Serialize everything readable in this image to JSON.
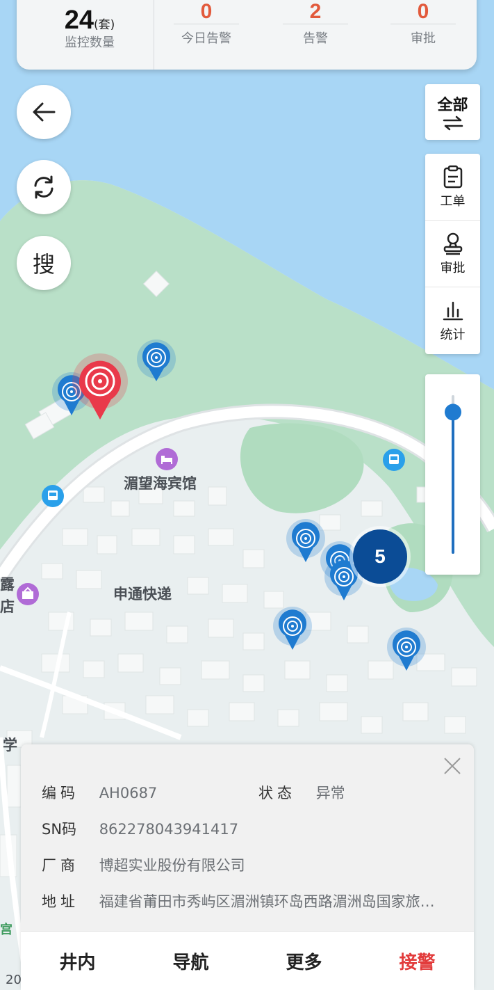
{
  "header": {
    "monitor_count": "24",
    "monitor_unit": "(套)",
    "monitor_label": "监控数量",
    "stats": [
      {
        "value": "0",
        "label": "今日告警"
      },
      {
        "value": "2",
        "label": "告警"
      },
      {
        "value": "0",
        "label": "审批"
      }
    ]
  },
  "left_buttons": {
    "search_label": "搜"
  },
  "side_panel": {
    "filter_label": "全部",
    "items": [
      {
        "label": "工单",
        "icon": "clipboard-icon"
      },
      {
        "label": "审批",
        "icon": "stamp-icon"
      },
      {
        "label": "统计",
        "icon": "bar-chart-icon"
      }
    ]
  },
  "map": {
    "labels": {
      "hotel": "湄望海宾馆",
      "express": "申通快递",
      "edge_top": "露",
      "edge_mid": "店",
      "edge_school": "学",
      "edge_bottom": "宫",
      "edge_scale": "20"
    },
    "cluster_count": "5",
    "zoom_level": 0.1,
    "colors": {
      "water": "#a8d6f5",
      "land": "#b9e0c8",
      "pin": "#1f7bd0",
      "alert_pin": "#e9394a",
      "cluster": "#0b4c96"
    }
  },
  "info": {
    "code_label": "编码",
    "code_value": "AH0687",
    "status_label": "状态",
    "status_value": "异常",
    "sn_label": "SN码",
    "sn_value": "862278043941417",
    "vendor_label": "厂商",
    "vendor_value": "博超实业股份有限公司",
    "address_label": "地址",
    "address_value": "福建省莆田市秀屿区湄洲镇环岛西路湄洲岛国家旅…"
  },
  "actions": [
    "井内",
    "导航",
    "更多",
    "接警"
  ]
}
